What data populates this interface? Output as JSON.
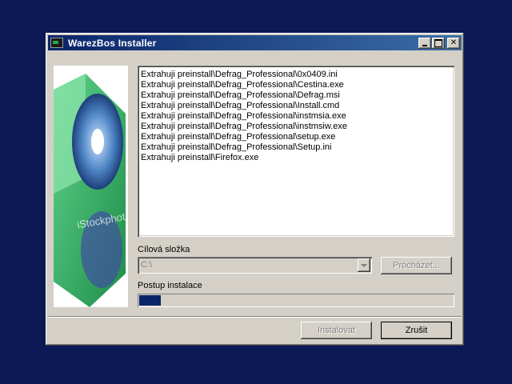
{
  "window": {
    "title": "WarezBos Installer",
    "titlebar_colors": [
      "#0a246a",
      "#3a6ea5"
    ]
  },
  "image": {
    "watermark": "iStockphoto",
    "colors": {
      "green": "#2fb45a",
      "disc": "#3f6fb3"
    }
  },
  "log": {
    "lines": [
      "Extrahuji preinstall\\Defrag_Professional\\0x0409.ini",
      "Extrahuji preinstall\\Defrag_Professional\\Cestina.exe",
      "Extrahuji preinstall\\Defrag_Professional\\Defrag.msi",
      "Extrahuji preinstall\\Defrag_Professional\\Install.cmd",
      "Extrahuji preinstall\\Defrag_Professional\\instmsia.exe",
      "Extrahuji preinstall\\Defrag_Professional\\instmsiw.exe",
      "Extrahuji preinstall\\Defrag_Professional\\setup.exe",
      "Extrahuji preinstall\\Defrag_Professional\\Setup.ini",
      "Extrahuji preinstall\\Firefox.exe"
    ]
  },
  "destination": {
    "label": "Cílová složka",
    "value": "C:\\",
    "browse_label": "Procházet..."
  },
  "progress": {
    "label": "Postup instalace",
    "percent": 7,
    "fill_color": "#0a246a"
  },
  "footer": {
    "install_label": "Instalovat",
    "cancel_label": "Zrušit"
  }
}
